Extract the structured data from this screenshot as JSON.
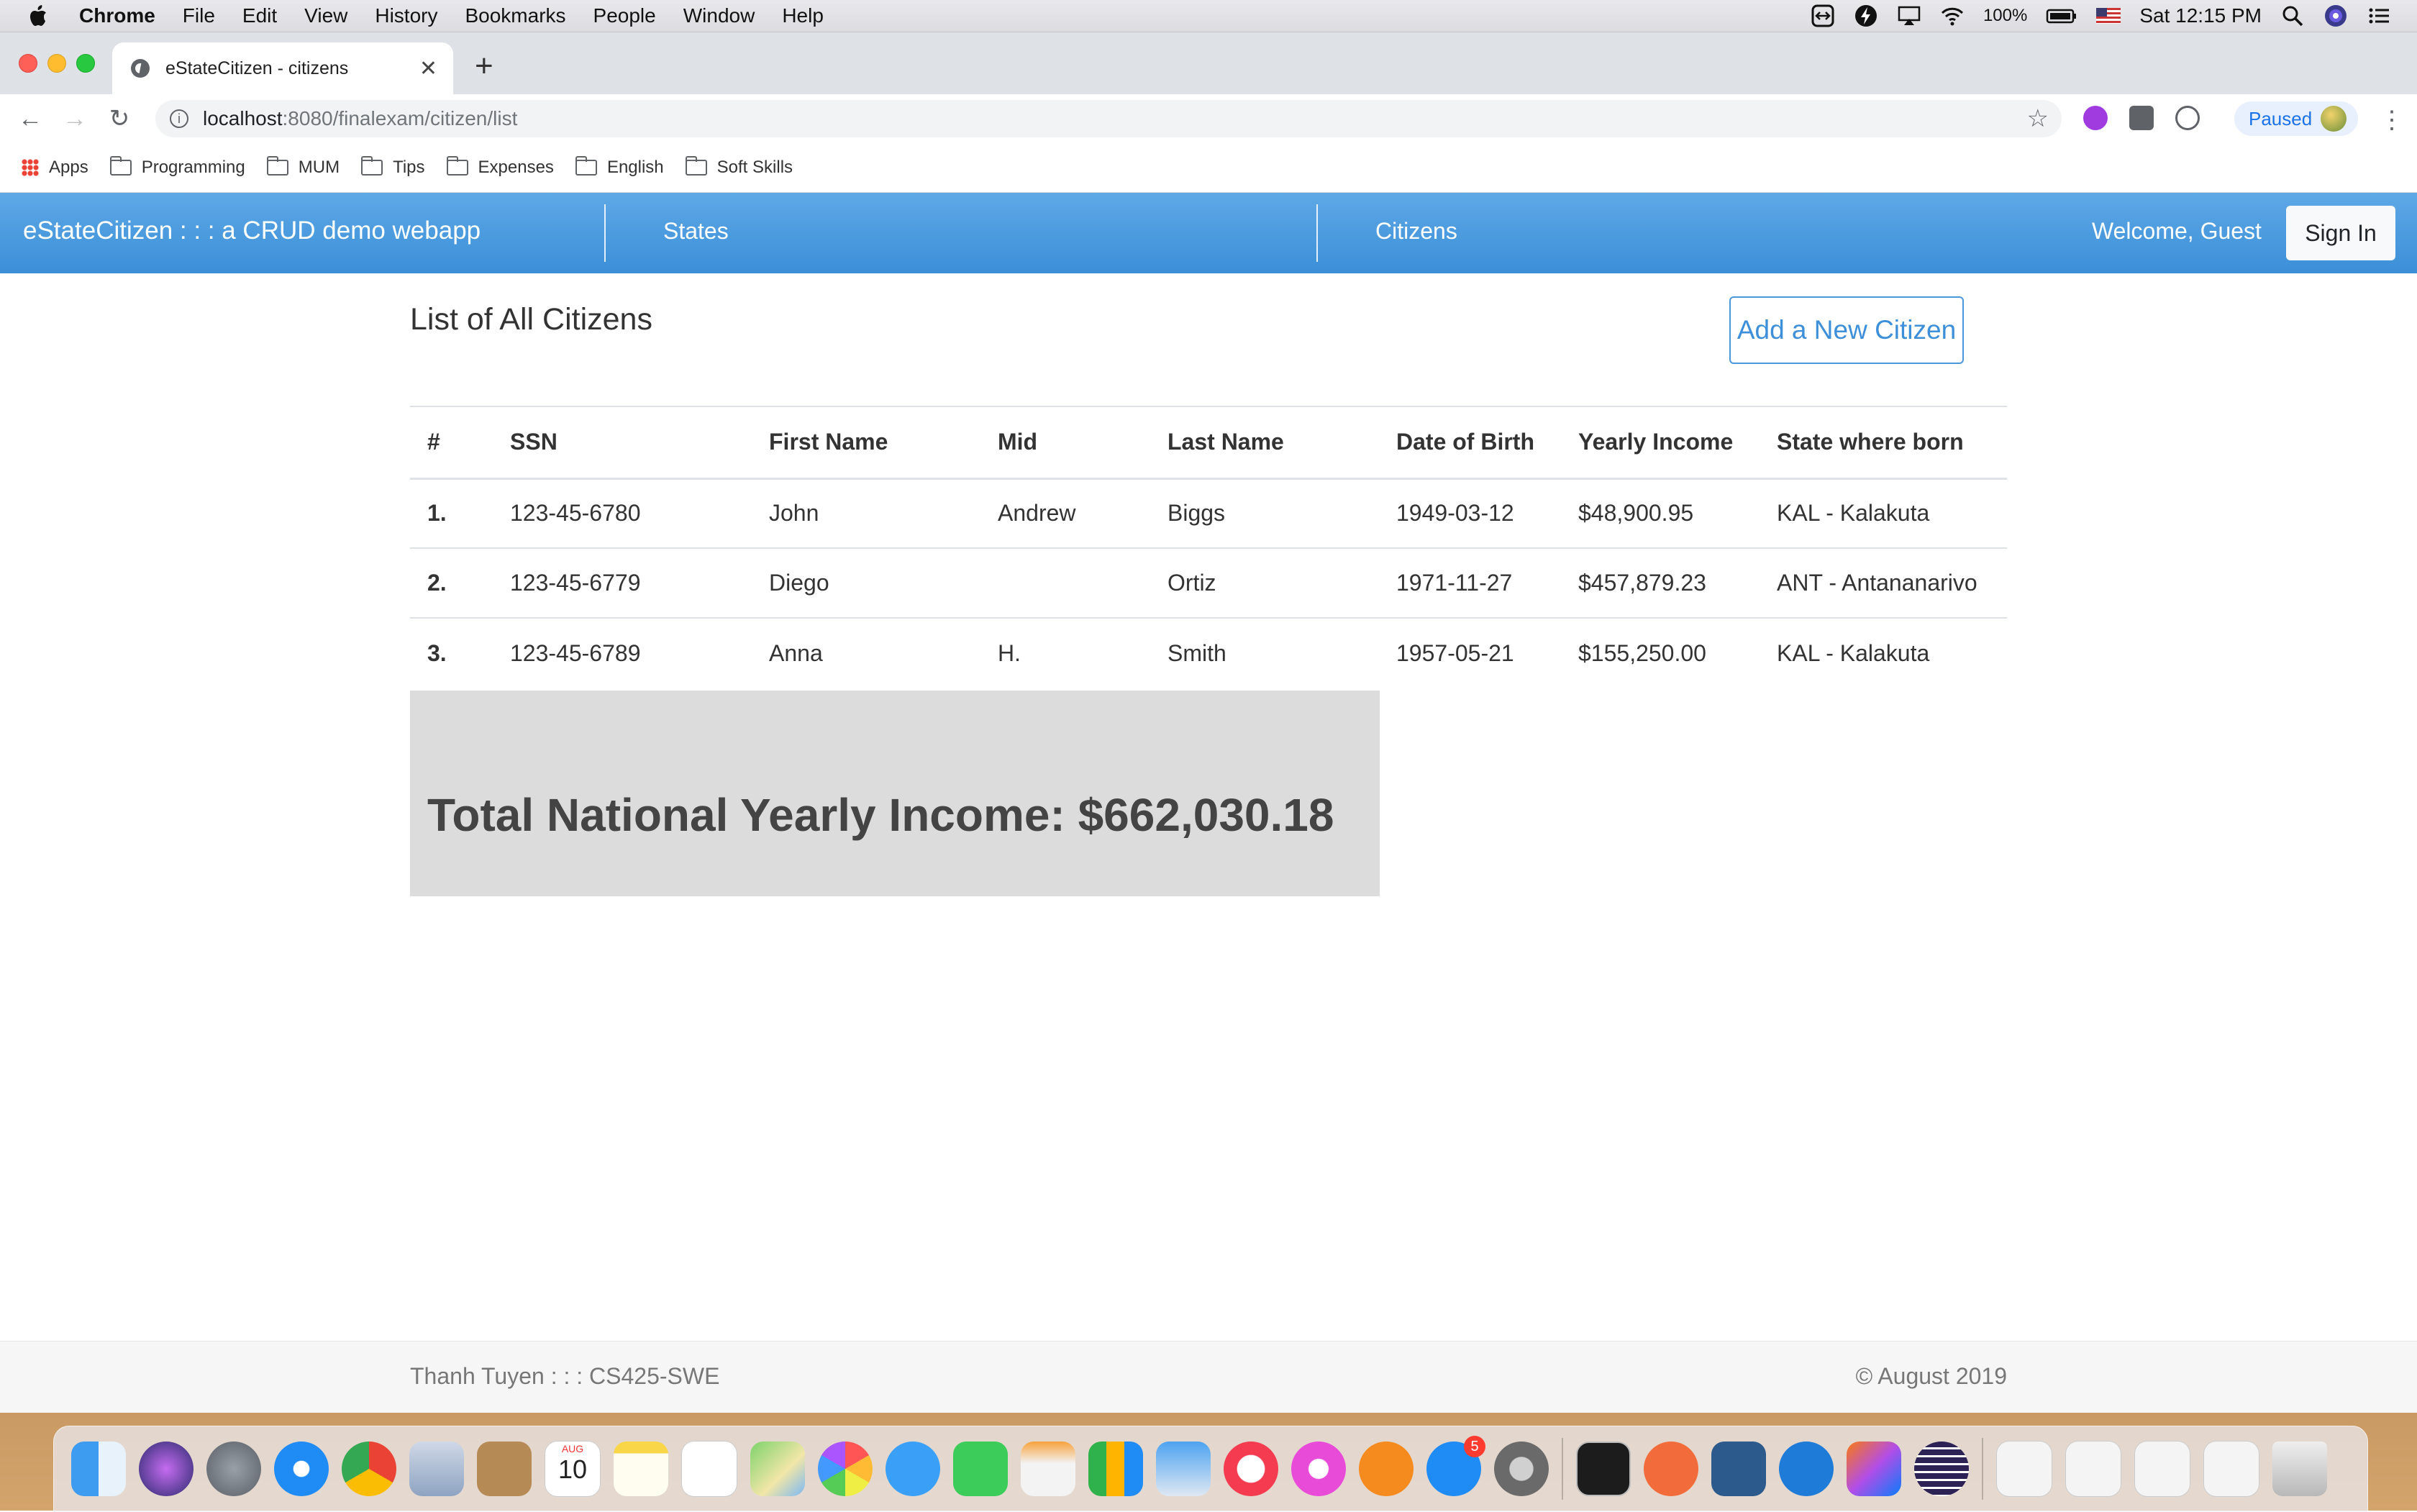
{
  "menubar": {
    "app_name": "Chrome",
    "menus": [
      "File",
      "Edit",
      "View",
      "History",
      "Bookmarks",
      "People",
      "Window",
      "Help"
    ],
    "battery": "100%",
    "clock": "Sat 12:15 PM"
  },
  "browser": {
    "tab_title": "eStateCitizen - citizens",
    "url_host": "localhost",
    "url_path": ":8080/finalexam/citizen/list",
    "profile_status": "Paused",
    "bookmarks": [
      "Apps",
      "Programming",
      "MUM",
      "Tips",
      "Expenses",
      "English",
      "Soft Skills"
    ]
  },
  "site": {
    "brand": "eStateCitizen : : : a CRUD demo webapp",
    "nav_links": [
      "States",
      "Citizens"
    ],
    "welcome": "Welcome, Guest",
    "sign_in": "Sign In"
  },
  "main": {
    "heading": "List of All Citizens",
    "add_button": "Add a New Citizen",
    "table": {
      "headers": [
        "#",
        "SSN",
        "First Name",
        "Mid",
        "Last Name",
        "Date of Birth",
        "Yearly Income",
        "State where born"
      ],
      "rows": [
        [
          "1.",
          "123-45-6780",
          "John",
          "Andrew",
          "Biggs",
          "1949-03-12",
          "$48,900.95",
          "KAL - Kalakuta"
        ],
        [
          "2.",
          "123-45-6779",
          "Diego",
          "",
          "Ortiz",
          "1971-11-27",
          "$457,879.23",
          "ANT - Antananarivo"
        ],
        [
          "3.",
          "123-45-6789",
          "Anna",
          "H.",
          "Smith",
          "1957-05-21",
          "$155,250.00",
          "KAL - Kalakuta"
        ]
      ]
    },
    "total": "Total National Yearly Income: $662,030.18"
  },
  "footer": {
    "left": "Thanh Tuyen : : : CS425-SWE",
    "right": "© August 2019"
  },
  "dock": {
    "calendar_month": "AUG",
    "calendar_day": "10",
    "app_store_badge": "5"
  },
  "colors": {
    "navbar": "#4a9be0",
    "accent": "#3d8fd9",
    "total_box": "#dcdcdc"
  }
}
